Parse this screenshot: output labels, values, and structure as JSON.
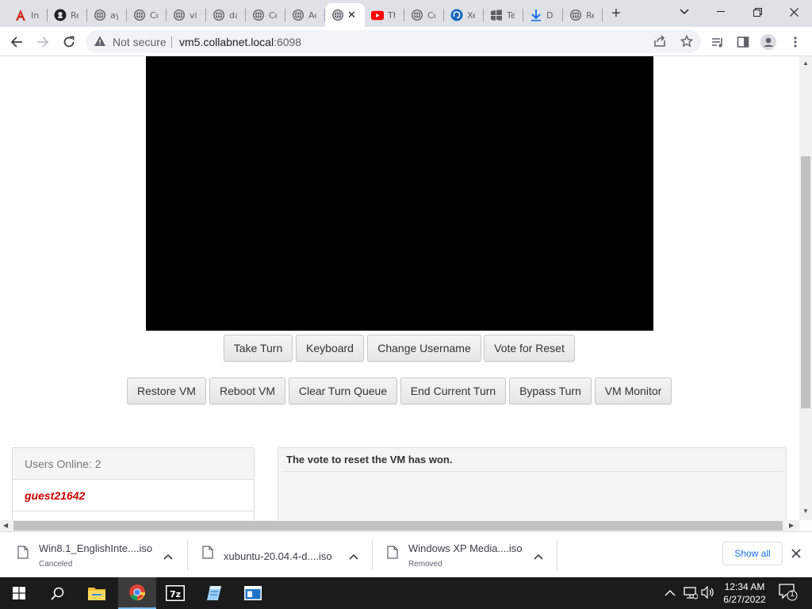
{
  "browser": {
    "tabs": [
      {
        "label": "In",
        "icon": "adobe-acrobat-icon"
      },
      {
        "label": "Re",
        "icon": "github-icon"
      },
      {
        "label": "ay",
        "icon": "globe-icon"
      },
      {
        "label": "Co",
        "icon": "globe-icon"
      },
      {
        "label": "vi",
        "icon": "globe-icon"
      },
      {
        "label": "da",
        "icon": "globe-icon"
      },
      {
        "label": "Co",
        "icon": "globe-icon"
      },
      {
        "label": "Ac",
        "icon": "globe-icon"
      },
      {
        "label": "",
        "icon": "globe-icon",
        "active": true
      },
      {
        "label": "Th",
        "icon": "youtube-icon"
      },
      {
        "label": "Co",
        "icon": "globe-icon"
      },
      {
        "label": "Xe",
        "icon": "mastodon-icon"
      },
      {
        "label": "Te",
        "icon": "windows-flag-icon"
      },
      {
        "label": "D",
        "icon": "download-icon"
      },
      {
        "label": "Re",
        "icon": "globe-icon"
      }
    ],
    "address": {
      "security": "Not secure",
      "host": "vm5.collabnet.local",
      "port": ":6098"
    }
  },
  "vm": {
    "row1": [
      "Take Turn",
      "Keyboard",
      "Change Username",
      "Vote for Reset"
    ],
    "row2": [
      "Restore VM",
      "Reboot VM",
      "Clear Turn Queue",
      "End Current Turn",
      "Bypass Turn",
      "VM Monitor"
    ]
  },
  "users": {
    "header": "Users Online: 2",
    "list": [
      "guest21642"
    ]
  },
  "chat": {
    "messages": [
      "The vote to reset the VM has won."
    ]
  },
  "downloads": {
    "items": [
      {
        "name": "Win8.1_EnglishInte....iso",
        "status": "Canceled"
      },
      {
        "name": "xubuntu-20.04.4-d....iso",
        "status": ""
      },
      {
        "name": "Windows XP Media....iso",
        "status": "Removed"
      }
    ],
    "show_all": "Show all"
  },
  "taskbar": {
    "time": "12:34 AM",
    "date": "6/27/2022",
    "notifications": "1"
  }
}
